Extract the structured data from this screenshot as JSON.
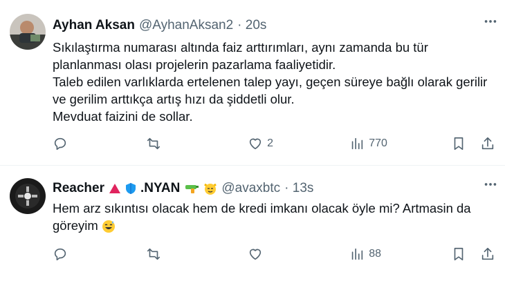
{
  "tweets": [
    {
      "author_name": "Ayhan Aksan",
      "handle": "@AyhanAksan2",
      "time": "· 20s",
      "lines": [
        "Sıkılaştırma numarası altında faiz arttırımları, aynı zamanda bu tür planlanması olası projelerin pazarlama faaliyetidir.",
        "Taleb edilen varlıklarda ertelenen talep yayı, geçen süreye bağlı olarak gerilir ve gerilim arttıkça artış hızı da şiddetli olur.",
        "Mevduat faizini de sollar."
      ],
      "likes": "2",
      "views": "770"
    },
    {
      "author_name": "Reacher",
      "name_suffix": ".NYAN",
      "handle": "@avaxbtc",
      "time": "· 13s",
      "text": "Hem arz sıkıntısı olacak hem de kredi imkanı olacak öyle mi? Artmasin da göreyim",
      "views": "88"
    }
  ],
  "icons": {
    "more": "more-icon",
    "reply": "reply-icon",
    "retweet": "retweet-icon",
    "like": "heart-icon",
    "views": "views-icon",
    "bookmark": "bookmark-icon",
    "share": "share-icon"
  },
  "colors": {
    "text": "#0f1419",
    "muted": "#536471",
    "divider": "#eff3f4"
  }
}
